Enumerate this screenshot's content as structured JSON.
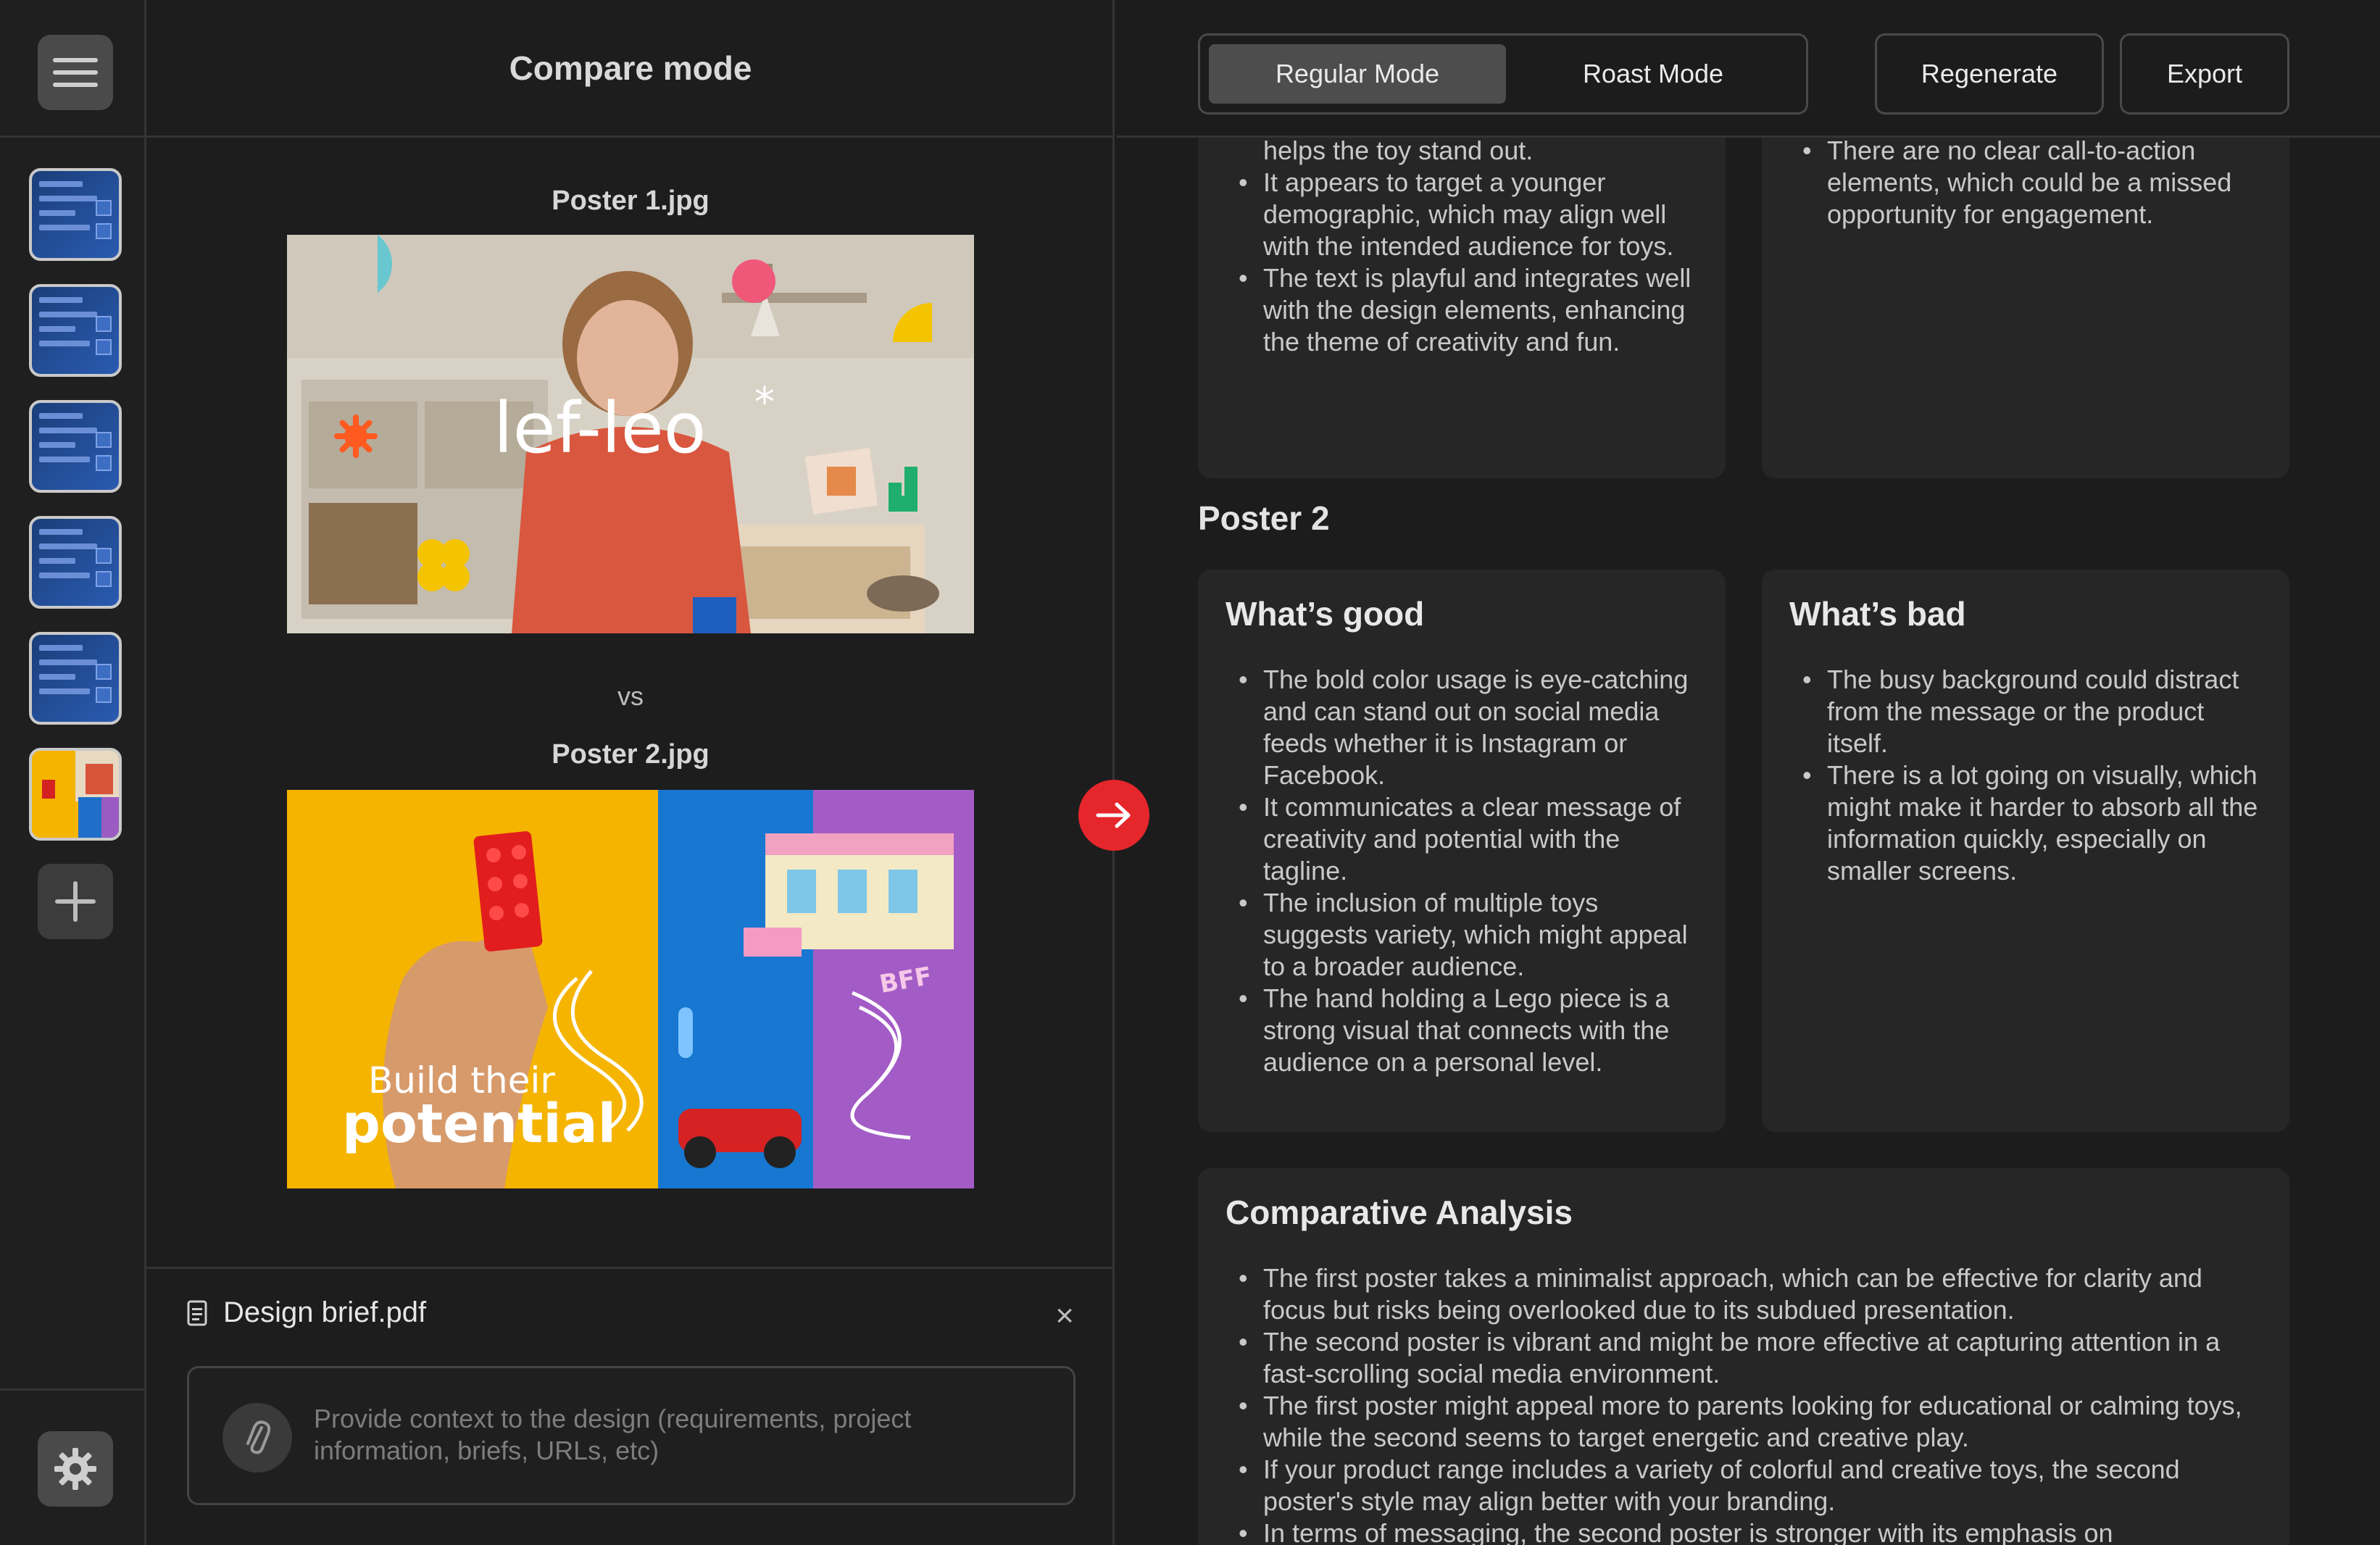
{
  "app": {
    "compare_title": "Compare mode"
  },
  "compare": {
    "poster1_label": "Poster 1.jpg",
    "vs_label": "vs",
    "poster2_label": "Poster 2.jpg",
    "poster1_logo_text": "lef-leo",
    "poster2_tagline_top": "Build their",
    "poster2_tagline_bottom": "potential",
    "poster2_sticker": "BFF"
  },
  "brief": {
    "file_name": "Design brief.pdf",
    "close_glyph": "×",
    "placeholder": "Provide context to the design (requirements, project information, briefs, URLs, etc)"
  },
  "header": {
    "mode_regular": "Regular Mode",
    "mode_roast": "Roast Mode",
    "regenerate": "Regenerate",
    "export": "Export"
  },
  "poster1_results": {
    "good_items": [
      "helps the toy stand out.",
      "It appears to target a younger demographic, which may align well with the intended audience for toys.",
      "The text is playful and integrates well with the design elements, enhancing the theme of creativity and fun."
    ],
    "bad_items": [
      "There are no clear call-to-action elements, which could be a missed opportunity for engagement."
    ]
  },
  "poster2_results": {
    "section_title": "Poster 2",
    "good_title": "What’s good",
    "good_items": [
      "The bold color usage is eye-catching and can stand out on social media feeds whether it is Instagram or Facebook.",
      "It communicates a clear message of creativity and potential with the tagline.",
      "The inclusion of multiple toys suggests variety, which might appeal to a broader audience.",
      "The hand holding a Lego piece is a strong visual that connects with the audience on a personal level."
    ],
    "bad_title": "What’s bad",
    "bad_items": [
      "The busy background could distract from the message or the product itself.",
      "There is a lot going on visually, which might make it harder to absorb all the information quickly, especially on smaller screens."
    ]
  },
  "comparative": {
    "title": "Comparative Analysis",
    "items": [
      "The first poster takes a minimalist approach, which can be effective for clarity and focus but risks being overlooked due to its subdued presentation.",
      "The second poster is vibrant and might be more effective at capturing attention in a fast-scrolling social media environment.",
      "The first poster might appeal more to parents looking for educational or calming toys, while the second seems to target energetic and creative play.",
      "If your product range includes a variety of colorful and creative toys, the second poster's style may align better with your branding.",
      "In terms of messaging, the second poster is stronger with its emphasis on"
    ]
  },
  "colors": {
    "accent_red": "#e5262b",
    "background": "#1c1c1c",
    "card": "#262626"
  }
}
